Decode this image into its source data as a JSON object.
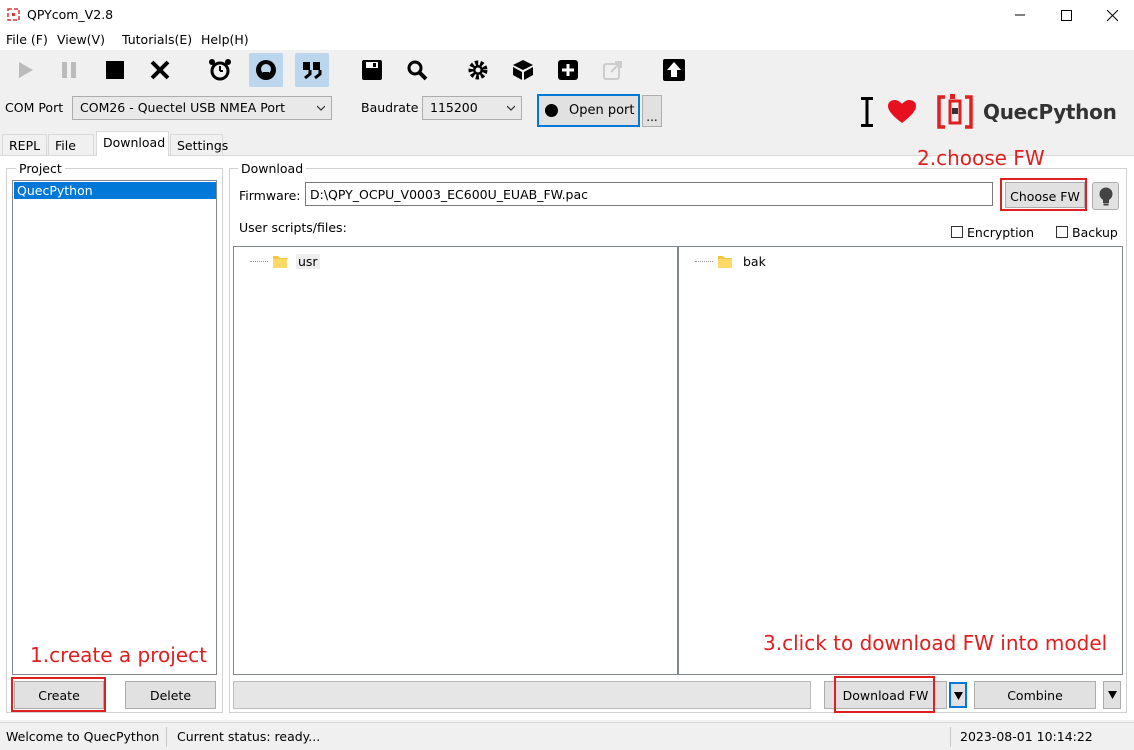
{
  "window": {
    "title": "QPYcom_V2.8"
  },
  "menu": {
    "items": [
      "File (F)",
      "View(V)",
      "Tutorials(E)",
      "Help(H)"
    ]
  },
  "toolbar": {
    "icons": [
      "play-icon",
      "pause-icon",
      "stop-icon",
      "close-icon",
      "alarm-clock-icon",
      "terminal-icon",
      "quote-icon",
      "save-icon",
      "search-icon",
      "gear-icon",
      "cube-icon",
      "add-icon",
      "external-link-icon",
      "upload-icon"
    ],
    "active_icons": [
      "terminal-icon",
      "quote-icon"
    ]
  },
  "com": {
    "port_label": "COM Port",
    "port_value": "COM26 - Quectel USB NMEA Port",
    "baud_label": "Baudrate",
    "baud_value": "115200",
    "open_label": "Open port",
    "more_label": "..."
  },
  "brand": {
    "name": "QuecPython",
    "color": "#e02020"
  },
  "tabs": [
    "REPL",
    "File",
    "Download",
    "Settings"
  ],
  "active_tab": "Download",
  "project": {
    "title": "Project",
    "items": [
      "QuecPython"
    ],
    "create_label": "Create",
    "delete_label": "Delete"
  },
  "download": {
    "title": "Download",
    "firmware_label": "Firmware:",
    "firmware_value": "D:\\QPY_OCPU_V0003_EC600U_EUAB_FW.pac",
    "choose_label": "Choose FW",
    "scripts_label": "User scripts/files:",
    "encryption_label": "Encryption",
    "backup_label": "Backup",
    "left_tree": [
      "usr"
    ],
    "right_tree": [
      "bak"
    ],
    "download_label": "Download FW",
    "combine_label": "Combine"
  },
  "annotations": {
    "step1": "1.create a project",
    "step2": "2.choose FW",
    "step3": "3.click to download FW into model",
    "color": "#e02020"
  },
  "status": {
    "welcome": "Welcome to QuecPython",
    "current": "Current status: ready...",
    "datetime": "2023-08-01 10:14:22"
  }
}
